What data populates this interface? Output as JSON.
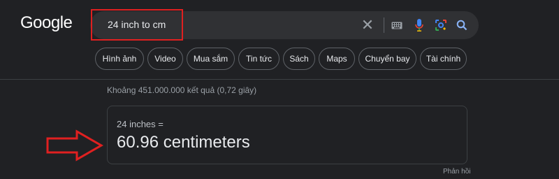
{
  "logo": "Google",
  "search": {
    "query": "24 inch to cm",
    "icons": [
      "clear-icon",
      "keyboard-icon",
      "mic-icon",
      "lens-icon",
      "search-icon"
    ]
  },
  "chips": [
    "Hình ảnh",
    "Video",
    "Mua sắm",
    "Tin tức",
    "Sách",
    "Maps",
    "Chuyển bay",
    "Tài chính"
  ],
  "results": {
    "stats": "Khoảng 451.000.000 kết quả (0,72 giây)",
    "converter": {
      "from": "24 inches =",
      "to": "60.96 centimeters"
    },
    "feedback": "Phản hồi"
  },
  "colors": {
    "background": "#202124",
    "searchbar": "#303134",
    "annotation": "#e02020"
  }
}
